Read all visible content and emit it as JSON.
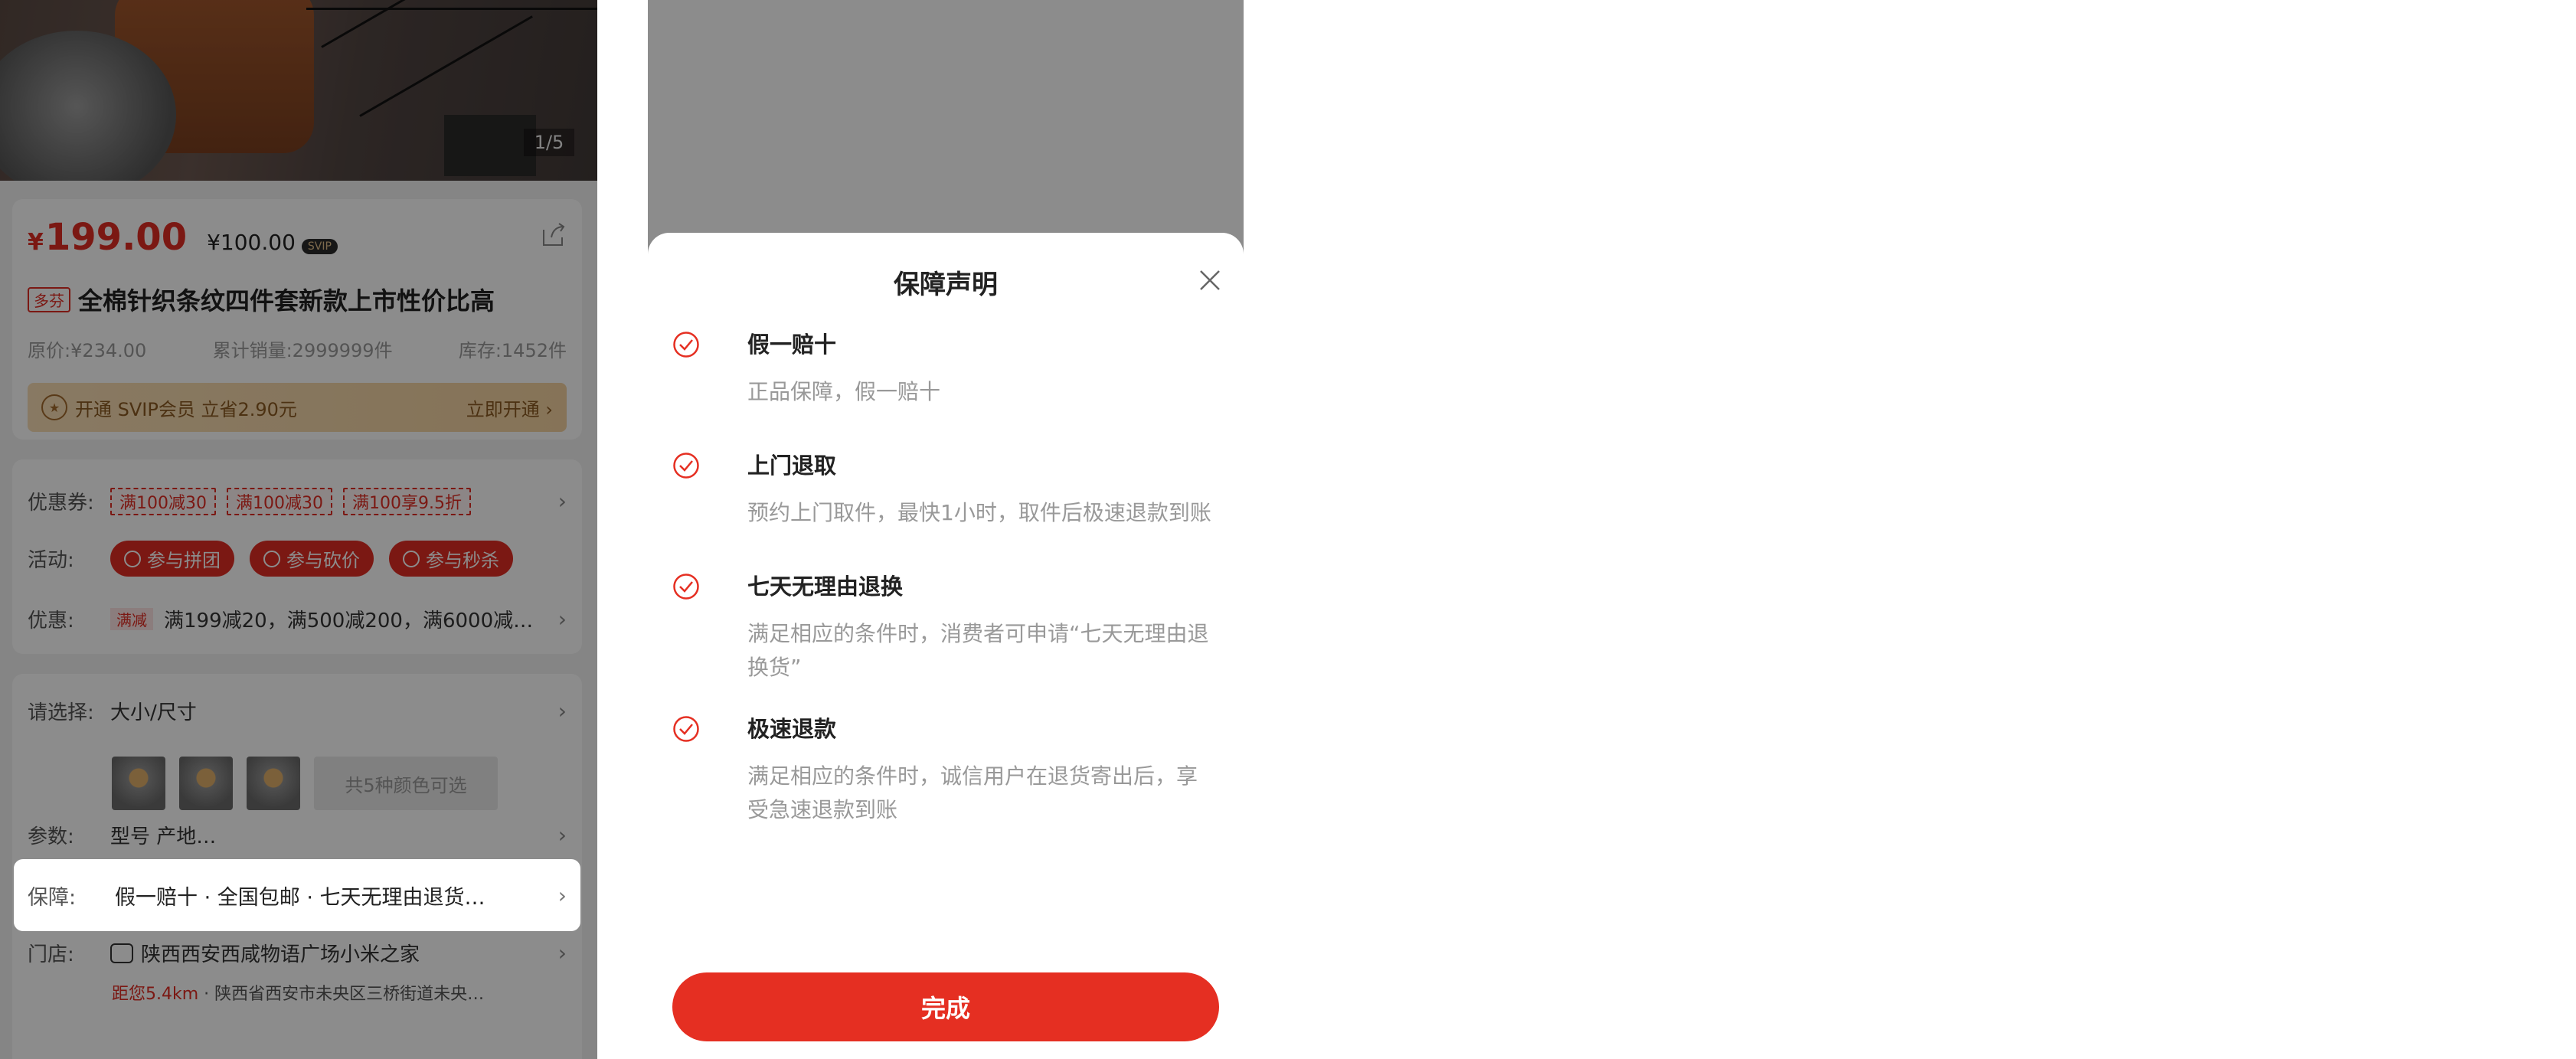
{
  "product": {
    "page_counter": "1/5",
    "price_symbol": "¥",
    "price": "199.00",
    "svip_price": "¥100.00",
    "svip_badge": "SVIP",
    "tag": "多芬",
    "title": "全棉针织条纹四件套新款上市性价比高",
    "original_price": "原价:¥234.00",
    "sales": "累计销量:2999999件",
    "stock": "库存:1452件",
    "svip_bar": {
      "text": "开通 SVIP会员 立省2.90元",
      "action": "立即开通"
    },
    "coupon_label": "优惠券:",
    "coupons": [
      "满100减30",
      "满100减30",
      "满100享9.5折"
    ],
    "activity_label": "活动:",
    "activities": [
      "参与拼团",
      "参与砍价",
      "参与秒杀"
    ],
    "discount_label": "优惠:",
    "discount_badge": "满减",
    "discount_text": "满199减20，满500减200，满6000减…",
    "select_label": "请选择:",
    "select_value": "大小/尺寸",
    "more_colors": "共5种颜色可选",
    "params_label": "参数:",
    "params_value": "型号 产地…",
    "guarantee_label": "保障:",
    "guarantee_value": "假一赔十 · 全国包邮 · 七天无理由退货…",
    "store_label": "门店:",
    "store_name": "陕西西安西咸物语广场小米之家",
    "store_distance": "距您5.4km",
    "store_address": "陕西省西安市未央区三桥街道未央…"
  },
  "modal": {
    "title": "保障声明",
    "items": [
      {
        "title": "假一赔十",
        "desc": "正品保障，假一赔十"
      },
      {
        "title": "上门退取",
        "desc": "预约上门取件，最快1小时，取件后极速退款到账"
      },
      {
        "title": "七天无理由退换",
        "desc": "满足相应的条件时，消费者可申请“七天无理由退换货”"
      },
      {
        "title": "极速退款",
        "desc": "满足相应的条件时，诚信用户在退货寄出后，享受急速退款到账"
      }
    ],
    "done_label": "完成"
  },
  "colors": {
    "accent": "#e52f22",
    "muted_text": "#999999",
    "svip_gold": "#f4d2a0"
  },
  "icons": [
    "share-icon",
    "close-icon",
    "check-circle-icon",
    "chevron-right-icon",
    "store-icon",
    "crown-icon"
  ]
}
